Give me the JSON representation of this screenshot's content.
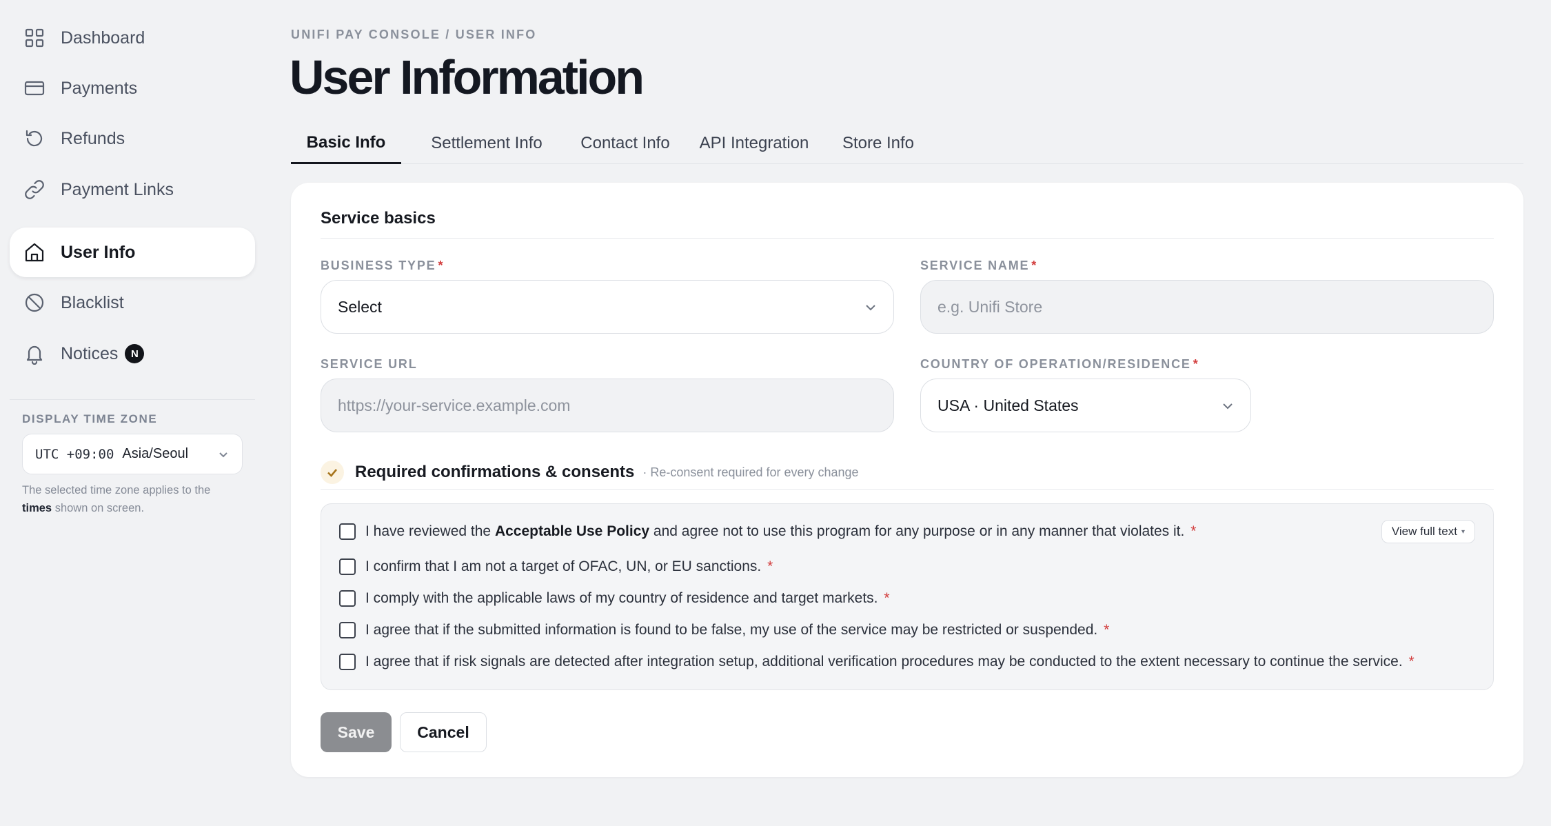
{
  "sidebar": {
    "items": [
      {
        "label": "Dashboard",
        "icon": "grid-icon"
      },
      {
        "label": "Payments",
        "icon": "card-icon"
      },
      {
        "label": "Refunds",
        "icon": "refund-icon"
      },
      {
        "label": "Payment Links",
        "icon": "link-icon"
      },
      {
        "label": "User Info",
        "icon": "home-icon",
        "active": true
      },
      {
        "label": "Blacklist",
        "icon": "block-icon"
      },
      {
        "label": "Notices",
        "icon": "bell-icon",
        "badge": "N"
      }
    ],
    "timezone": {
      "label": "DISPLAY TIME ZONE",
      "offset": "UTC +09:00",
      "name": "Asia/Seoul",
      "note_prefix": "The selected time zone applies to the",
      "note_bold": "times",
      "note_suffix": "shown on screen."
    }
  },
  "header": {
    "breadcrumb": "UNIFI PAY CONSOLE / USER INFO",
    "title": "User Information"
  },
  "tabs": [
    {
      "label": "Basic Info",
      "active": true
    },
    {
      "label": "Settlement Info"
    },
    {
      "label": "Contact Info"
    },
    {
      "label": "API Integration"
    },
    {
      "label": "Store Info"
    }
  ],
  "form": {
    "section_title": "Service basics",
    "business_type": {
      "label": "BUSINESS TYPE",
      "value": "Select",
      "required": "*"
    },
    "service_name": {
      "label": "SERVICE NAME",
      "placeholder": "e.g. Unifi Store",
      "required": "*"
    },
    "service_url": {
      "label": "SERVICE URL",
      "placeholder": "https://your-service.example.com"
    },
    "country": {
      "label": "COUNTRY OF OPERATION/RESIDENCE",
      "value": "USA · United States",
      "required": "*"
    }
  },
  "consents": {
    "title": "Required confirmations & consents",
    "note": "· Re-consent required for every change",
    "view_full_text": "View full text",
    "items": [
      {
        "pre": "I have reviewed the",
        "bold": "Acceptable Use Policy",
        "post": "and agree not to use this program for any purpose or in any manner that violates it.",
        "required": "*"
      },
      {
        "pre": "I confirm that I am not a target of OFAC, UN, or EU sanctions.",
        "required": "*"
      },
      {
        "pre": "I comply with the applicable laws of my country of residence and target markets.",
        "required": "*"
      },
      {
        "pre": "I agree that if the submitted information is found to be false, my use of the service may be restricted or suspended.",
        "required": "*"
      },
      {
        "pre": "I agree that if risk signals are detected after integration setup, additional verification procedures may be conducted to the extent necessary to continue the service.",
        "required": "*"
      }
    ]
  },
  "actions": {
    "save": "Save",
    "cancel": "Cancel"
  }
}
